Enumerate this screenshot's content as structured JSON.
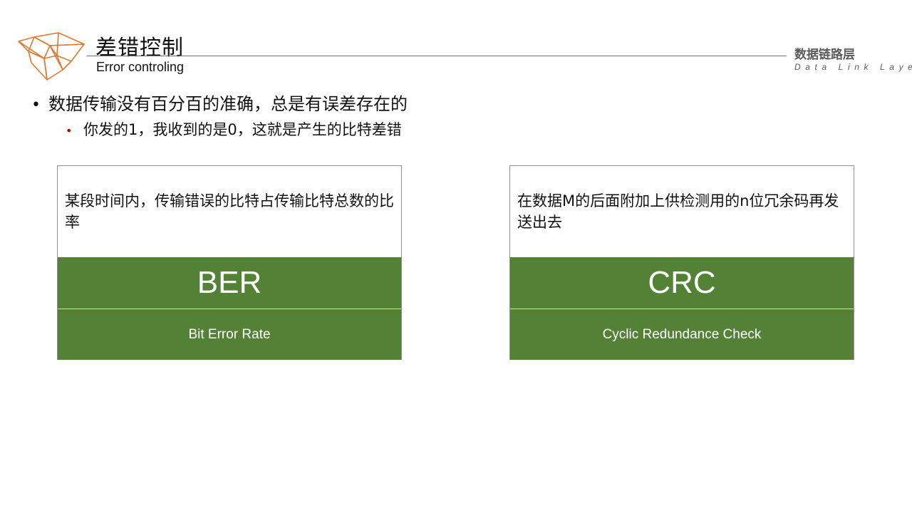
{
  "header": {
    "title": "差错控制",
    "subtitle": "Error controling",
    "section_title": "数据链路层",
    "section_subtitle": "Data Link Layer",
    "logo_icon": "geometric-polygon-logo",
    "accent_color": "#E0782F"
  },
  "content": {
    "bullet_main": "数据传输没有百分百的准确，总是有误差存在的",
    "bullet_sub": "你发的1，我收到的是0，这就是产生的比特差错"
  },
  "cards": [
    {
      "description": "某段时间内，传输错误的比特占传输比特总数的比率",
      "abbreviation": "BER",
      "full_name": "Bit Error Rate"
    },
    {
      "description": "在数据M的后面附加上供检测用的n位冗余码再发送出去",
      "abbreviation": "CRC",
      "full_name": "Cyclic Redundance Check"
    }
  ],
  "colors": {
    "card_green": "#538135",
    "bullet_red": "#C00000"
  }
}
